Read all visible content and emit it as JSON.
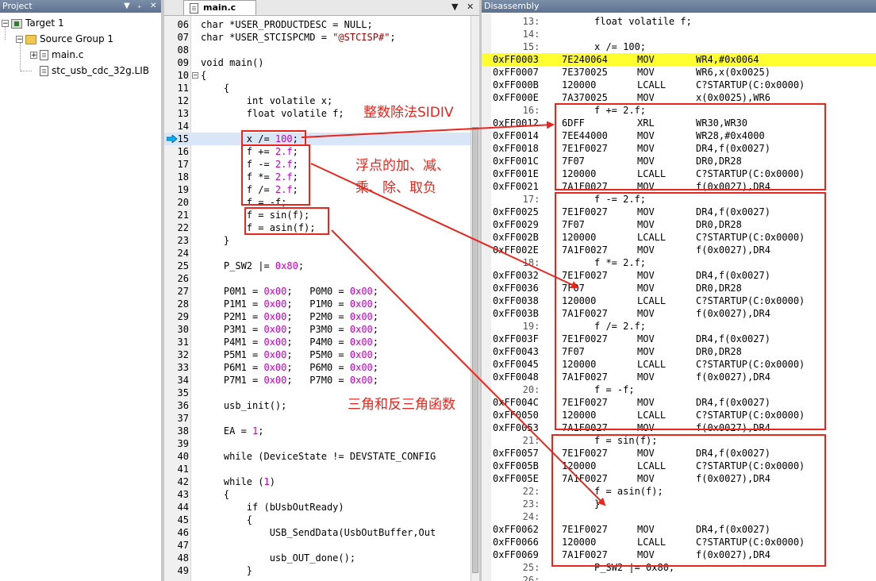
{
  "project_pane": {
    "title": "Project",
    "controls": [
      "▼",
      "₊",
      "✕"
    ],
    "tree": [
      {
        "label": "Target 1",
        "level": 0,
        "icon": "target-icon",
        "expander": "−"
      },
      {
        "label": "Source Group 1",
        "level": 1,
        "icon": "folder-icon",
        "expander": "−"
      },
      {
        "label": "main.c",
        "level": 2,
        "icon": "file-icon",
        "expander": "+"
      },
      {
        "label": "stc_usb_cdc_32g.LIB",
        "level": 2,
        "icon": "file-icon",
        "expander": ""
      }
    ]
  },
  "editor": {
    "tab_label": "main.c",
    "tab_controls": [
      "▼",
      "✕"
    ],
    "lines": [
      {
        "n": "06",
        "t": "char *USER_PRODUCTDESC = NULL;"
      },
      {
        "n": "07",
        "t": "char *USER_STCISPCMD = \"@STCISP#\";"
      },
      {
        "n": "08",
        "t": ""
      },
      {
        "n": "09",
        "t": "void main()"
      },
      {
        "n": "10",
        "t": "{",
        "fold": "−"
      },
      {
        "n": "11",
        "t": "    {"
      },
      {
        "n": "12",
        "t": "        int volatile x;"
      },
      {
        "n": "13",
        "t": "        float volatile f;"
      },
      {
        "n": "14",
        "t": ""
      },
      {
        "n": "15",
        "t": "        x /= 100;",
        "hl": true
      },
      {
        "n": "16",
        "t": "        f += 2.f;"
      },
      {
        "n": "17",
        "t": "        f -= 2.f;"
      },
      {
        "n": "18",
        "t": "        f *= 2.f;"
      },
      {
        "n": "19",
        "t": "        f /= 2.f;"
      },
      {
        "n": "20",
        "t": "        f = -f;"
      },
      {
        "n": "21",
        "t": "        f = sin(f);"
      },
      {
        "n": "22",
        "t": "        f = asin(f);"
      },
      {
        "n": "23",
        "t": "    }"
      },
      {
        "n": "24",
        "t": ""
      },
      {
        "n": "25",
        "t": "    P_SW2 |= 0x80;"
      },
      {
        "n": "26",
        "t": ""
      },
      {
        "n": "27",
        "t": "    P0M1 = 0x00;   P0M0 = 0x00;"
      },
      {
        "n": "28",
        "t": "    P1M1 = 0x00;   P1M0 = 0x00;"
      },
      {
        "n": "29",
        "t": "    P2M1 = 0x00;   P2M0 = 0x00;"
      },
      {
        "n": "30",
        "t": "    P3M1 = 0x00;   P3M0 = 0x00;"
      },
      {
        "n": "31",
        "t": "    P4M1 = 0x00;   P4M0 = 0x00;"
      },
      {
        "n": "32",
        "t": "    P5M1 = 0x00;   P5M0 = 0x00;"
      },
      {
        "n": "33",
        "t": "    P6M1 = 0x00;   P6M0 = 0x00;"
      },
      {
        "n": "34",
        "t": "    P7M1 = 0x00;   P7M0 = 0x00;"
      },
      {
        "n": "35",
        "t": ""
      },
      {
        "n": "36",
        "t": "    usb_init();"
      },
      {
        "n": "37",
        "t": ""
      },
      {
        "n": "38",
        "t": "    EA = 1;"
      },
      {
        "n": "39",
        "t": ""
      },
      {
        "n": "40",
        "t": "    while (DeviceState != DEVSTATE_CONFIG"
      },
      {
        "n": "41",
        "t": ""
      },
      {
        "n": "42",
        "t": "    while (1)"
      },
      {
        "n": "43",
        "t": "    {"
      },
      {
        "n": "44",
        "t": "        if (bUsbOutReady)"
      },
      {
        "n": "45",
        "t": "        {"
      },
      {
        "n": "46",
        "t": "            USB_SendData(UsbOutBuffer,Out"
      },
      {
        "n": "47",
        "t": ""
      },
      {
        "n": "48",
        "t": "            usb_OUT_done();"
      },
      {
        "n": "49",
        "t": "        }"
      }
    ]
  },
  "disassembly": {
    "title": "Disassembly",
    "rows": [
      {
        "src": "13:",
        "code": "float volatile f;"
      },
      {
        "src": "14:",
        "code": ""
      },
      {
        "src": "15:",
        "code": "x /= 100;"
      },
      {
        "addr": "0xFF0003",
        "hex": "7E240064",
        "mn": "MOV",
        "op": "WR4,#0x0064",
        "cur": true
      },
      {
        "addr": "0xFF0007",
        "hex": "7E370025",
        "mn": "MOV",
        "op": "WR6,x(0x0025)"
      },
      {
        "addr": "0xFF000B",
        "hex": "120000",
        "mn": "LCALL",
        "op": "C?STARTUP(C:0x0000)"
      },
      {
        "addr": "0xFF000E",
        "hex": "7A370025",
        "mn": "MOV",
        "op": "x(0x0025),WR6"
      },
      {
        "src": "16:",
        "code": "f += 2.f;"
      },
      {
        "addr": "0xFF0012",
        "hex": "6DFF",
        "mn": "XRL",
        "op": "WR30,WR30"
      },
      {
        "addr": "0xFF0014",
        "hex": "7EE44000",
        "mn": "MOV",
        "op": "WR28,#0x4000"
      },
      {
        "addr": "0xFF0018",
        "hex": "7E1F0027",
        "mn": "MOV",
        "op": "DR4,f(0x0027)"
      },
      {
        "addr": "0xFF001C",
        "hex": "7F07",
        "mn": "MOV",
        "op": "DR0,DR28"
      },
      {
        "addr": "0xFF001E",
        "hex": "120000",
        "mn": "LCALL",
        "op": "C?STARTUP(C:0x0000)"
      },
      {
        "addr": "0xFF0021",
        "hex": "7A1F0027",
        "mn": "MOV",
        "op": "f(0x0027),DR4"
      },
      {
        "src": "17:",
        "code": "f -= 2.f;"
      },
      {
        "addr": "0xFF0025",
        "hex": "7E1F0027",
        "mn": "MOV",
        "op": "DR4,f(0x0027)"
      },
      {
        "addr": "0xFF0029",
        "hex": "7F07",
        "mn": "MOV",
        "op": "DR0,DR28"
      },
      {
        "addr": "0xFF002B",
        "hex": "120000",
        "mn": "LCALL",
        "op": "C?STARTUP(C:0x0000)"
      },
      {
        "addr": "0xFF002E",
        "hex": "7A1F0027",
        "mn": "MOV",
        "op": "f(0x0027),DR4"
      },
      {
        "src": "18:",
        "code": "f *= 2.f;"
      },
      {
        "addr": "0xFF0032",
        "hex": "7E1F0027",
        "mn": "MOV",
        "op": "DR4,f(0x0027)"
      },
      {
        "addr": "0xFF0036",
        "hex": "7F07",
        "mn": "MOV",
        "op": "DR0,DR28"
      },
      {
        "addr": "0xFF0038",
        "hex": "120000",
        "mn": "LCALL",
        "op": "C?STARTUP(C:0x0000)"
      },
      {
        "addr": "0xFF003B",
        "hex": "7A1F0027",
        "mn": "MOV",
        "op": "f(0x0027),DR4"
      },
      {
        "src": "19:",
        "code": "f /= 2.f;"
      },
      {
        "addr": "0xFF003F",
        "hex": "7E1F0027",
        "mn": "MOV",
        "op": "DR4,f(0x0027)"
      },
      {
        "addr": "0xFF0043",
        "hex": "7F07",
        "mn": "MOV",
        "op": "DR0,DR28"
      },
      {
        "addr": "0xFF0045",
        "hex": "120000",
        "mn": "LCALL",
        "op": "C?STARTUP(C:0x0000)"
      },
      {
        "addr": "0xFF0048",
        "hex": "7A1F0027",
        "mn": "MOV",
        "op": "f(0x0027),DR4"
      },
      {
        "src": "20:",
        "code": "f = -f;"
      },
      {
        "addr": "0xFF004C",
        "hex": "7E1F0027",
        "mn": "MOV",
        "op": "DR4,f(0x0027)"
      },
      {
        "addr": "0xFF0050",
        "hex": "120000",
        "mn": "LCALL",
        "op": "C?STARTUP(C:0x0000)"
      },
      {
        "addr": "0xFF0053",
        "hex": "7A1F0027",
        "mn": "MOV",
        "op": "f(0x0027),DR4"
      },
      {
        "src": "21:",
        "code": "f = sin(f);"
      },
      {
        "addr": "0xFF0057",
        "hex": "7E1F0027",
        "mn": "MOV",
        "op": "DR4,f(0x0027)"
      },
      {
        "addr": "0xFF005B",
        "hex": "120000",
        "mn": "LCALL",
        "op": "C?STARTUP(C:0x0000)"
      },
      {
        "addr": "0xFF005E",
        "hex": "7A1F0027",
        "mn": "MOV",
        "op": "f(0x0027),DR4"
      },
      {
        "src": "22:",
        "code": "f = asin(f);"
      },
      {
        "src": "23:",
        "code": "}"
      },
      {
        "src": "24:",
        "code": ""
      },
      {
        "addr": "0xFF0062",
        "hex": "7E1F0027",
        "mn": "MOV",
        "op": "DR4,f(0x0027)"
      },
      {
        "addr": "0xFF0066",
        "hex": "120000",
        "mn": "LCALL",
        "op": "C?STARTUP(C:0x0000)"
      },
      {
        "addr": "0xFF0069",
        "hex": "7A1F0027",
        "mn": "MOV",
        "op": "f(0x0027),DR4"
      },
      {
        "src": "25:",
        "code": "P_SW2 |= 0x80;"
      },
      {
        "src": "26:",
        "code": ""
      }
    ]
  },
  "annotations": {
    "color": "#e8261d",
    "int_div": "整数除法SIDIV",
    "float_ops_1": "浮点的加、减、",
    "float_ops_2": "乘、除、取负",
    "trig": "三角和反三角函数"
  }
}
